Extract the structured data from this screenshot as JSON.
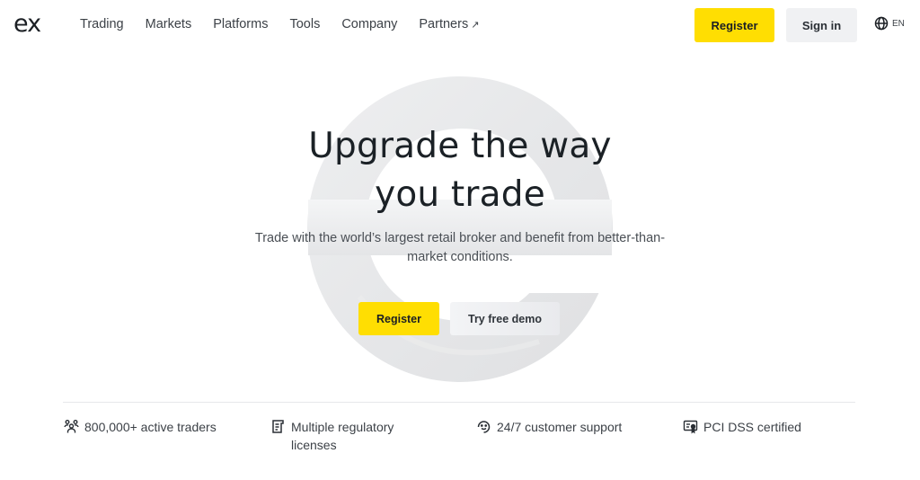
{
  "header": {
    "logo": "ex",
    "nav": [
      {
        "label": "Trading"
      },
      {
        "label": "Markets"
      },
      {
        "label": "Platforms"
      },
      {
        "label": "Tools"
      },
      {
        "label": "Company"
      },
      {
        "label": "Partners",
        "icon": "external-arrow-icon",
        "arrow": "↗"
      }
    ],
    "register_label": "Register",
    "signin_label": "Sign in",
    "language": "EN"
  },
  "hero": {
    "title_line1": "Upgrade the way",
    "title_line2": "you trade",
    "subtitle": "Trade with the world’s largest retail broker and benefit from better-than-market conditions.",
    "register_label": "Register",
    "demo_label": "Try free demo"
  },
  "features": [
    {
      "icon": "users-icon",
      "text": "800,000+ active traders"
    },
    {
      "icon": "license-document-icon",
      "text": "Multiple regulatory licenses"
    },
    {
      "icon": "support-headset-icon",
      "text": "24/7 customer support"
    },
    {
      "icon": "certificate-icon",
      "text": "PCI DSS certified"
    }
  ],
  "colors": {
    "accent": "#ffde02",
    "secondary_button": "#f0f1f3",
    "text": "#1b2126"
  }
}
